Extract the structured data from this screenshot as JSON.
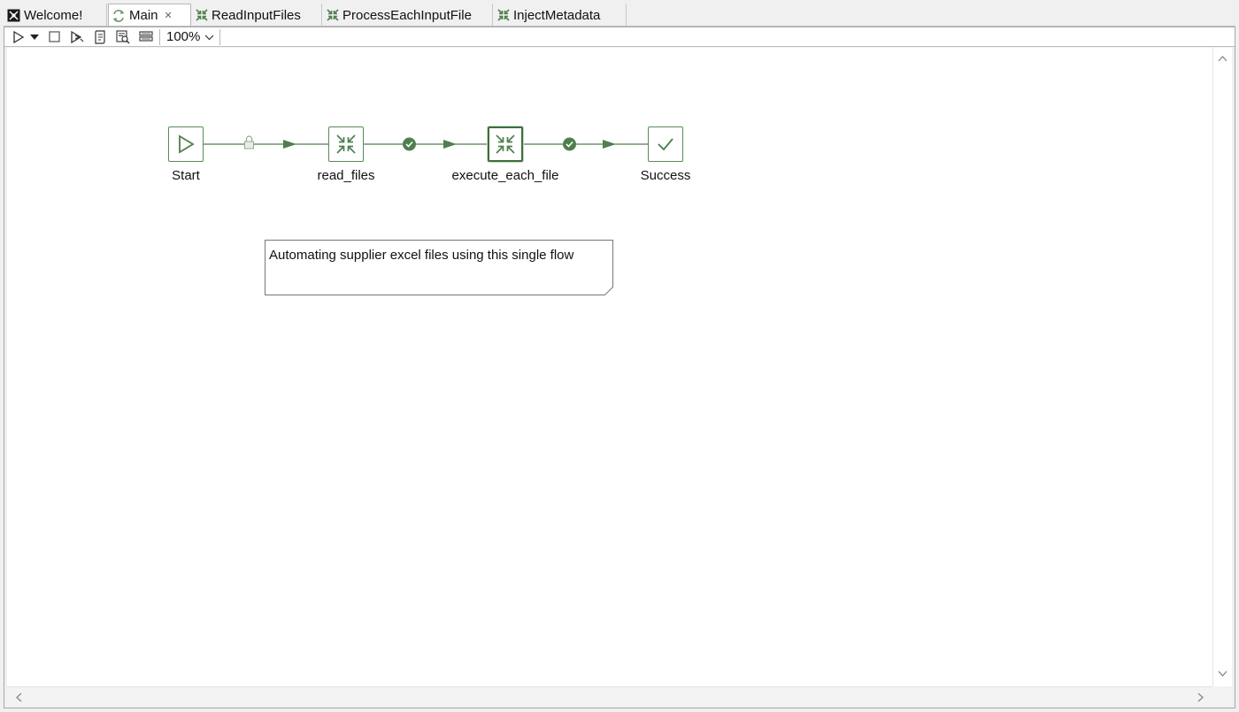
{
  "tabs": [
    {
      "label": "Welcome!",
      "icon": "welcome-icon"
    },
    {
      "label": "Main",
      "icon": "job-icon",
      "active": true,
      "closable": true
    },
    {
      "label": "ReadInputFiles",
      "icon": "transformation-icon"
    },
    {
      "label": "ProcessEachInputFile",
      "icon": "transformation-icon"
    },
    {
      "label": "InjectMetadata",
      "icon": "transformation-icon"
    }
  ],
  "toolbar": {
    "zoom": "100%",
    "buttons": [
      "run-icon",
      "run-options-icon",
      "stop-icon",
      "replay-icon",
      "sql-icon",
      "impact-icon",
      "layout-icon"
    ]
  },
  "nodes": [
    {
      "label": "Start",
      "icon": "play-icon"
    },
    {
      "label": "read_files",
      "icon": "collapse-arrows-icon"
    },
    {
      "label": "execute_each_file",
      "icon": "collapse-arrows-icon",
      "selected": true
    },
    {
      "label": "Success",
      "icon": "checkmark-icon"
    }
  ],
  "hops": [
    {
      "from": "Start",
      "to": "read_files",
      "type": "unconditional",
      "icon": "lock-icon"
    },
    {
      "from": "read_files",
      "to": "execute_each_file",
      "type": "success",
      "icon": "check-circle-icon"
    },
    {
      "from": "execute_each_file",
      "to": "Success",
      "type": "success",
      "icon": "check-circle-icon"
    }
  ],
  "note": {
    "text": "Automating supplier excel files using this single flow"
  },
  "colors": {
    "hop": "#4f7f4f",
    "node_border": "#5b8a5b",
    "lock": "#9aa89a"
  }
}
